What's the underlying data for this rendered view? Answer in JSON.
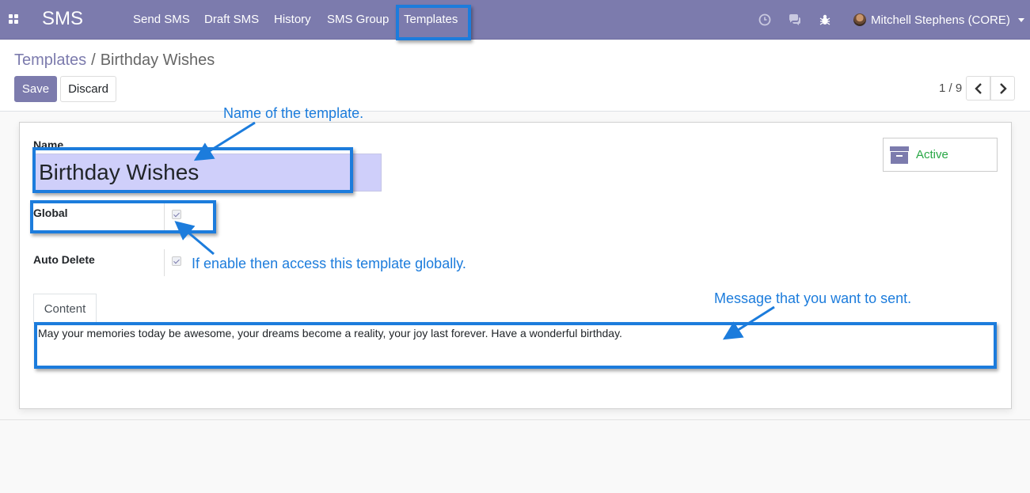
{
  "navbar": {
    "app_title": "SMS",
    "menu": [
      {
        "label": "Send SMS"
      },
      {
        "label": "Draft SMS"
      },
      {
        "label": "History"
      },
      {
        "label": "SMS Group"
      },
      {
        "label": "Templates"
      }
    ],
    "user_name": "Mitchell Stephens (CORE)",
    "icons": [
      "apps-grid-icon",
      "clock-icon",
      "chat-icon",
      "bug-icon",
      "avatar",
      "caret-down-icon"
    ]
  },
  "control_panel": {
    "breadcrumb_parent": "Templates",
    "breadcrumb_separator": "/",
    "breadcrumb_current": "Birthday Wishes",
    "save_label": "Save",
    "discard_label": "Discard",
    "pager_value": "1 / 9"
  },
  "form": {
    "name_label": "Name",
    "name_value": "Birthday Wishes",
    "active_label": "Active",
    "global_label": "Global",
    "global_checked": true,
    "auto_delete_label": "Auto Delete",
    "auto_delete_checked": true,
    "tab_content_label": "Content",
    "message": "May your memories today be awesome, your dreams become a reality, your joy last forever. Have a wonderful birthday."
  },
  "annotations": {
    "name_note": "Name of the template.",
    "global_note": "If enable then access this template globally.",
    "message_note": "Message that you want to sent."
  },
  "colors": {
    "brand": "#7c7bad",
    "annotation": "#1c7cdc",
    "active": "#28a745",
    "name_field_bg": "#cfcffa"
  }
}
